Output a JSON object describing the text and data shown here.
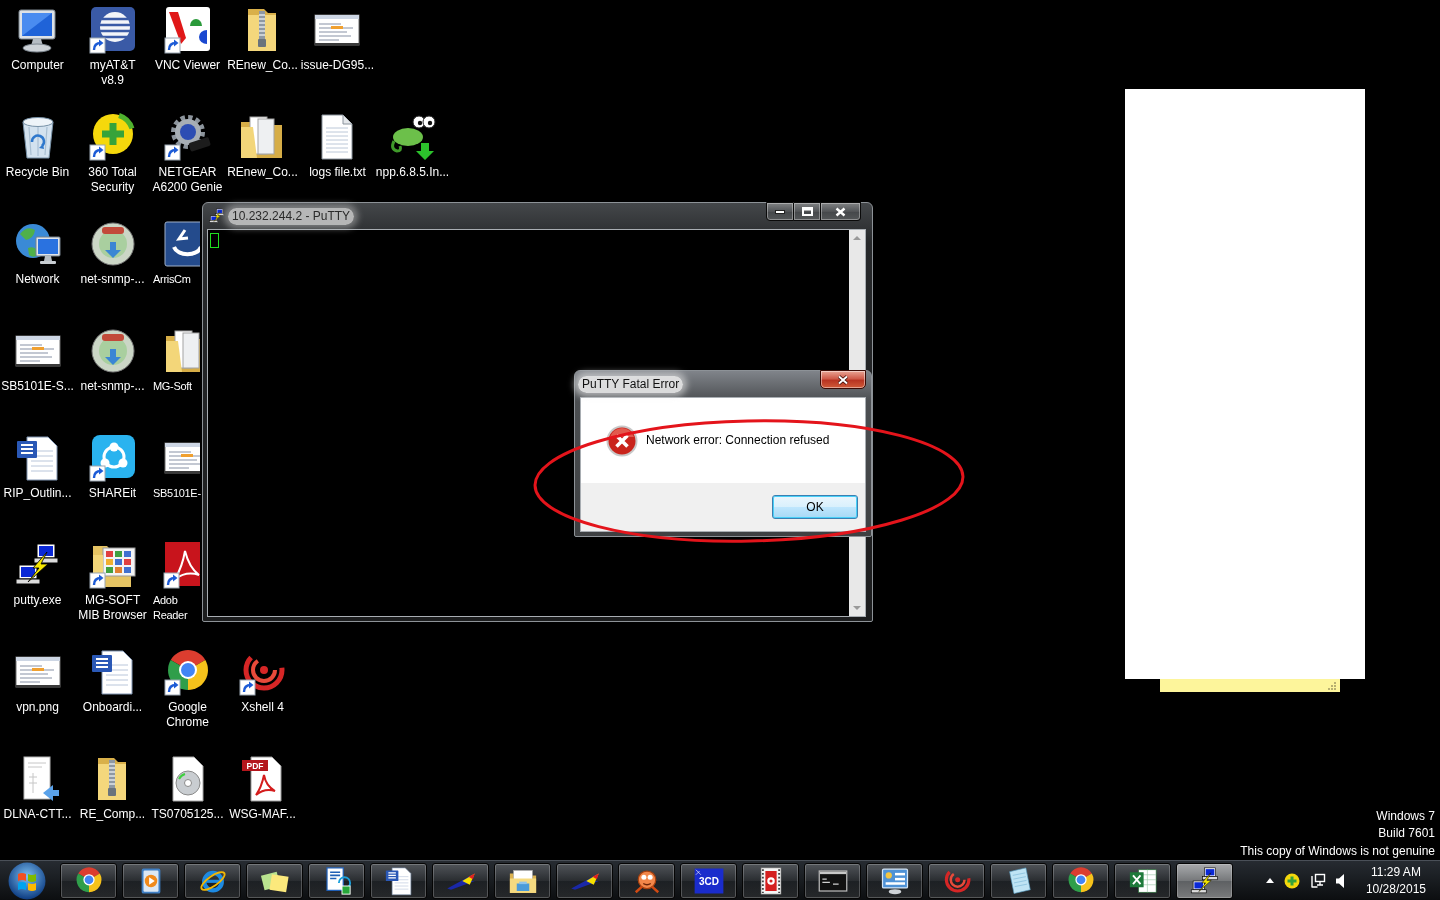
{
  "desktop": {
    "rows": [
      {
        "icons": [
          {
            "label": "Computer",
            "covered": false
          },
          {
            "label": "myAT&T v8.9",
            "covered": false
          },
          {
            "label": "VNC Viewer",
            "covered": false
          },
          {
            "label": "REnew_Co...",
            "covered": false
          },
          {
            "label": "issue-DG95...",
            "covered": false
          }
        ]
      },
      {
        "icons": [
          {
            "label": "Recycle Bin",
            "covered": false
          },
          {
            "label": "360 Total Security",
            "covered": false
          },
          {
            "label": "NETGEAR A6200 Genie",
            "covered": false
          },
          {
            "label": "REnew_Co...",
            "covered": false
          },
          {
            "label": "logs file.txt",
            "covered": false
          },
          {
            "label": "npp.6.8.5.In...",
            "covered": false
          }
        ]
      },
      {
        "icons": [
          {
            "label": "Network",
            "covered": false
          },
          {
            "label": "net-snmp-...",
            "covered": false
          },
          {
            "label": "ArrisCm",
            "covered": true
          }
        ]
      },
      {
        "icons": [
          {
            "label": "SB5101E-S...",
            "covered": false
          },
          {
            "label": "net-snmp-...",
            "covered": false
          },
          {
            "label": "MG-Soft",
            "covered": true
          }
        ]
      },
      {
        "icons": [
          {
            "label": "RIP_Outlin...",
            "covered": false
          },
          {
            "label": "SHAREit",
            "covered": false
          },
          {
            "label": "SB5101E-",
            "covered": true
          }
        ]
      },
      {
        "icons": [
          {
            "label": "putty.exe",
            "covered": false
          },
          {
            "label": "MG-SOFT MIB Browser",
            "covered": false
          },
          {
            "label": "Adob Reader",
            "covered": true
          }
        ]
      },
      {
        "icons": [
          {
            "label": "vpn.png",
            "covered": false
          },
          {
            "label": "Onboardi...",
            "covered": false
          },
          {
            "label": "Google Chrome",
            "covered": false
          },
          {
            "label": "Xshell 4",
            "covered": false
          }
        ]
      },
      {
        "icons": [
          {
            "label": "DLNA-CTT...",
            "covered": false
          },
          {
            "label": "RE_Comp...",
            "covered": false
          },
          {
            "label": "TS0705125...",
            "covered": false
          },
          {
            "label": "WSG-MAF...",
            "covered": false,
            "badge": "PDF"
          }
        ]
      }
    ]
  },
  "putty_window": {
    "title": "10.232.244.2 - PuTTY",
    "active": false,
    "cursor_shown": true
  },
  "error_dialog": {
    "title": "PuTTY Fatal Error",
    "active": true,
    "message": "Network error: Connection refused",
    "buttons": [
      {
        "label": "OK",
        "default": true
      }
    ]
  },
  "annotation": {
    "kind": "ellipse"
  },
  "system_notice": {
    "lines": [
      "Windows 7",
      "Build 7601",
      "This copy of Windows is not genuine"
    ]
  },
  "taskbar": {
    "buttons": [
      {
        "selected": false
      },
      {
        "selected": false
      },
      {
        "selected": false
      },
      {
        "selected": false
      },
      {
        "selected": false
      },
      {
        "selected": false
      },
      {
        "selected": false
      },
      {
        "selected": false
      },
      {
        "selected": false
      },
      {
        "selected": false
      },
      {
        "selected": false,
        "badge": "3CD"
      },
      {
        "selected": false
      },
      {
        "selected": false
      },
      {
        "selected": false
      },
      {
        "selected": false
      },
      {
        "selected": false
      },
      {
        "selected": false
      },
      {
        "selected": false
      },
      {
        "selected": true
      }
    ],
    "clock": {
      "time": "11:29 AM",
      "date": "10/28/2015"
    }
  }
}
